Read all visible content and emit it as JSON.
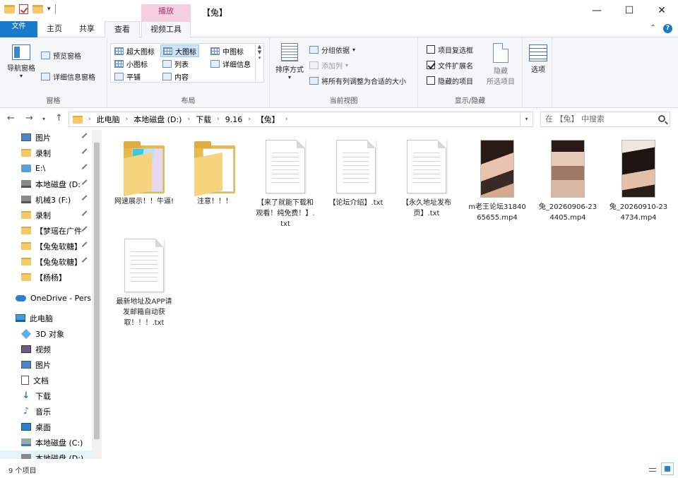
{
  "window": {
    "title": "【兔】",
    "context_tab_header": "播放",
    "minimize": "—",
    "maximize": "☐",
    "close": "✕"
  },
  "ribbon_tabs": [
    "文件",
    "主页",
    "共享",
    "查看",
    "视频工具"
  ],
  "ribbon": {
    "panes": {
      "label": "窗格",
      "nav_pane": "导航窗格",
      "preview_pane": "预览窗格",
      "details_pane": "详细信息窗格"
    },
    "layout": {
      "label": "布局",
      "items": [
        "超大图标",
        "大图标",
        "中图标",
        "小图标",
        "列表",
        "详细信息",
        "平铺",
        "内容"
      ]
    },
    "current_view": {
      "label": "当前视图",
      "sort_by": "排序方式",
      "group_by": "分组依据",
      "add_columns": "添加列",
      "size_all_columns": "将所有列调整为合适的大小"
    },
    "show_hide": {
      "label": "显示/隐藏",
      "item_checkboxes": "项目复选框",
      "file_extensions": "文件扩展名",
      "hidden_items": "隐藏的项目",
      "hide_selected_line1": "隐藏",
      "hide_selected_line2": "所选项目",
      "options": "选项"
    }
  },
  "address": {
    "crumbs": [
      "此电脑",
      "本地磁盘 (D:)",
      "下载",
      "9.16",
      "【兔】"
    ],
    "search_placeholder": "在 【兔】 中搜索"
  },
  "nav_pane": {
    "quick_access": [
      {
        "label": "图片",
        "icon": "pictures-icon",
        "pinned": true
      },
      {
        "label": "录制",
        "icon": "folder-icon",
        "pinned": true
      },
      {
        "label": "E:\\",
        "icon": "network-drive-icon",
        "pinned": true
      },
      {
        "label": "本地磁盘 (D:",
        "icon": "drive-icon",
        "pinned": true
      },
      {
        "label": "机械3 (F:)",
        "icon": "drive-icon",
        "pinned": true
      },
      {
        "label": "录制",
        "icon": "folder-icon",
        "pinned": true
      },
      {
        "label": "【梦瑶在广件",
        "icon": "folder-icon",
        "pinned": true
      },
      {
        "label": "【兔兔软糖】",
        "icon": "folder-icon",
        "pinned": true
      },
      {
        "label": "【兔兔软糖】",
        "icon": "folder-icon",
        "pinned": true
      },
      {
        "label": "【杨杨】",
        "icon": "folder-icon",
        "pinned": false
      }
    ],
    "onedrive": "OneDrive - Pers",
    "this_pc": "此电脑",
    "pc_items": [
      {
        "label": "3D 对象",
        "icon": "3d-objects-icon"
      },
      {
        "label": "视频",
        "icon": "videos-icon"
      },
      {
        "label": "图片",
        "icon": "pictures-icon"
      },
      {
        "label": "文档",
        "icon": "documents-icon"
      },
      {
        "label": "下载",
        "icon": "downloads-icon"
      },
      {
        "label": "音乐",
        "icon": "music-icon"
      },
      {
        "label": "桌面",
        "icon": "desktop-icon"
      },
      {
        "label": "本地磁盘 (C:)",
        "icon": "windows-drive-icon"
      },
      {
        "label": "本地磁盘 (D:)",
        "icon": "drive-icon"
      }
    ]
  },
  "files": [
    {
      "name": "网速展示！！牛逼!",
      "type": "folder",
      "variant": "colored"
    },
    {
      "name": "注意！！！",
      "type": "folder",
      "variant": "plain"
    },
    {
      "name": "【来了就能下载和观看！纯免费！】.txt",
      "type": "txt"
    },
    {
      "name": "【论坛介绍】.txt",
      "type": "txt"
    },
    {
      "name": "【永久地址发布页】.txt",
      "type": "txt"
    },
    {
      "name": "m老王论坛3184065655.mp4",
      "type": "video",
      "variant": "v1"
    },
    {
      "name": "兔_20260906-234405.mp4",
      "type": "video",
      "variant": "v2"
    },
    {
      "name": "兔_20260910-234734.mp4",
      "type": "video",
      "variant": "v3"
    },
    {
      "name": "最新地址及APP请发邮箱自动获取！！！.txt",
      "type": "txt"
    }
  ],
  "status": {
    "item_count": "9 个项目"
  }
}
